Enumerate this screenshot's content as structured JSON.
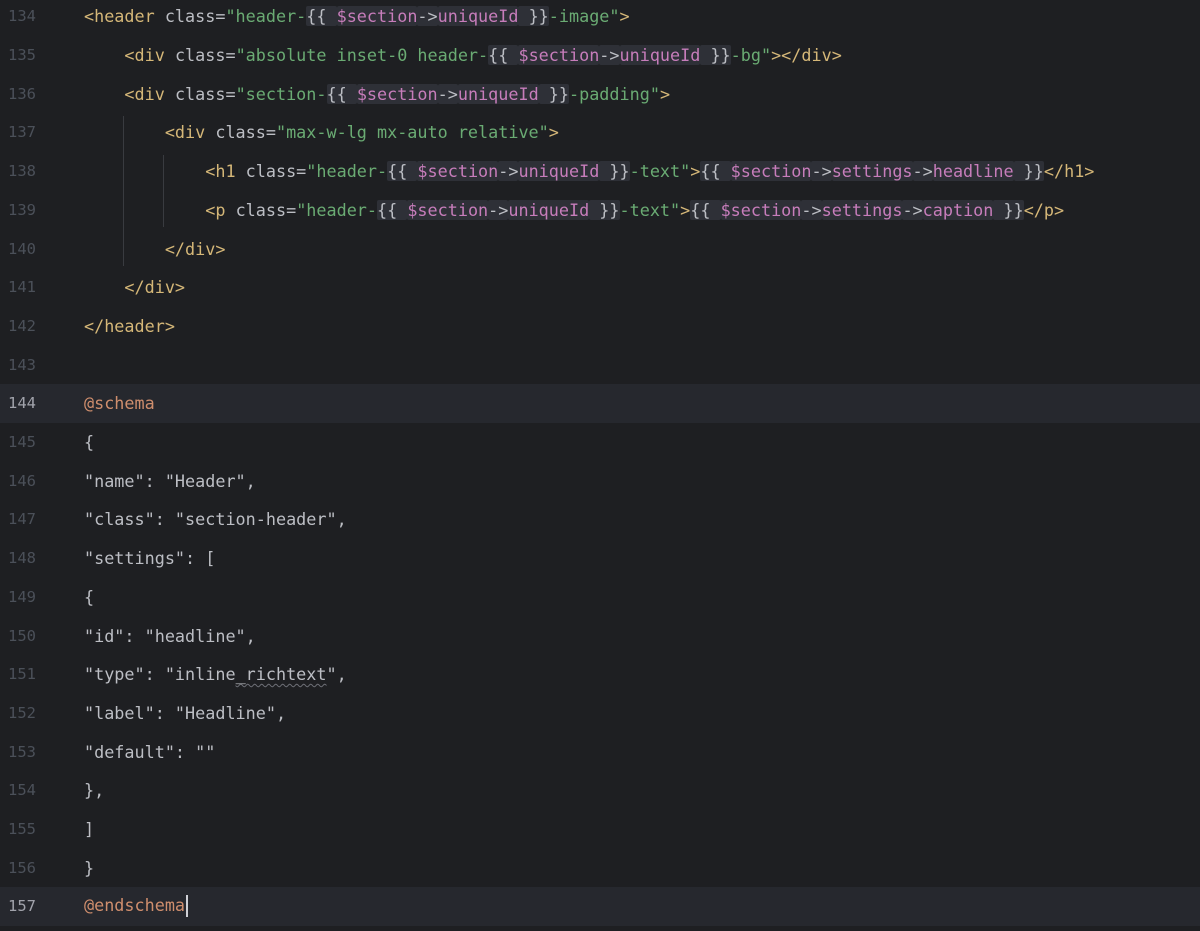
{
  "editor": {
    "lines": [
      {
        "number": "134",
        "tokens": [
          {
            "t": "<header ",
            "c": "tag"
          },
          {
            "t": "class=",
            "c": "attr"
          },
          {
            "t": "\"header-",
            "c": "str"
          },
          {
            "t": "{{ ",
            "c": "plain hl"
          },
          {
            "t": "$section",
            "c": "var hl"
          },
          {
            "t": "->",
            "c": "plain hl"
          },
          {
            "t": "uniqueId",
            "c": "var hl"
          },
          {
            "t": " }}",
            "c": "plain hl"
          },
          {
            "t": "-image\"",
            "c": "str"
          },
          {
            "t": ">",
            "c": "tag"
          }
        ]
      },
      {
        "number": "135",
        "tokens": [
          {
            "t": "    <div ",
            "c": "tag"
          },
          {
            "t": "class=",
            "c": "attr"
          },
          {
            "t": "\"absolute inset-0 header-",
            "c": "str"
          },
          {
            "t": "{{ ",
            "c": "plain hl"
          },
          {
            "t": "$section",
            "c": "var hl"
          },
          {
            "t": "->",
            "c": "plain hl"
          },
          {
            "t": "uniqueId",
            "c": "var hl"
          },
          {
            "t": " }}",
            "c": "plain hl"
          },
          {
            "t": "-bg\"",
            "c": "str"
          },
          {
            "t": "></div>",
            "c": "tag"
          }
        ]
      },
      {
        "number": "136",
        "tokens": [
          {
            "t": "    <div ",
            "c": "tag"
          },
          {
            "t": "class=",
            "c": "attr"
          },
          {
            "t": "\"section-",
            "c": "str"
          },
          {
            "t": "{{ ",
            "c": "plain hl"
          },
          {
            "t": "$section",
            "c": "var hl"
          },
          {
            "t": "->",
            "c": "plain hl"
          },
          {
            "t": "uniqueId",
            "c": "var hl"
          },
          {
            "t": " }}",
            "c": "plain hl"
          },
          {
            "t": "-padding\"",
            "c": "str"
          },
          {
            "t": ">",
            "c": "tag"
          }
        ]
      },
      {
        "number": "137",
        "tokens": [
          {
            "t": "        <div ",
            "c": "tag"
          },
          {
            "t": "class=",
            "c": "attr"
          },
          {
            "t": "\"max-w-lg mx-auto relative\"",
            "c": "str"
          },
          {
            "t": ">",
            "c": "tag"
          }
        ]
      },
      {
        "number": "138",
        "tokens": [
          {
            "t": "            <h1 ",
            "c": "tag"
          },
          {
            "t": "class=",
            "c": "attr"
          },
          {
            "t": "\"header-",
            "c": "str"
          },
          {
            "t": "{{ ",
            "c": "plain hl"
          },
          {
            "t": "$section",
            "c": "var hl"
          },
          {
            "t": "->",
            "c": "plain hl"
          },
          {
            "t": "uniqueId",
            "c": "var hl"
          },
          {
            "t": " }}",
            "c": "plain hl"
          },
          {
            "t": "-text\"",
            "c": "str"
          },
          {
            "t": ">",
            "c": "tag"
          },
          {
            "t": "{{ ",
            "c": "plain hl"
          },
          {
            "t": "$section",
            "c": "var hl"
          },
          {
            "t": "->",
            "c": "plain hl"
          },
          {
            "t": "settings",
            "c": "var hl"
          },
          {
            "t": "->",
            "c": "plain hl"
          },
          {
            "t": "headline",
            "c": "var hl"
          },
          {
            "t": " }}",
            "c": "plain hl"
          },
          {
            "t": "</h1>",
            "c": "tag"
          }
        ]
      },
      {
        "number": "139",
        "tokens": [
          {
            "t": "            <p ",
            "c": "tag"
          },
          {
            "t": "class=",
            "c": "attr"
          },
          {
            "t": "\"header-",
            "c": "str"
          },
          {
            "t": "{{ ",
            "c": "plain hl"
          },
          {
            "t": "$section",
            "c": "var hl"
          },
          {
            "t": "->",
            "c": "plain hl"
          },
          {
            "t": "uniqueId",
            "c": "var hl"
          },
          {
            "t": " }}",
            "c": "plain hl"
          },
          {
            "t": "-text\"",
            "c": "str"
          },
          {
            "t": ">",
            "c": "tag"
          },
          {
            "t": "{{ ",
            "c": "plain hl"
          },
          {
            "t": "$section",
            "c": "var hl"
          },
          {
            "t": "->",
            "c": "plain hl"
          },
          {
            "t": "settings",
            "c": "var hl"
          },
          {
            "t": "->",
            "c": "plain hl"
          },
          {
            "t": "caption",
            "c": "var hl"
          },
          {
            "t": " }}",
            "c": "plain hl"
          },
          {
            "t": "</p>",
            "c": "tag"
          }
        ]
      },
      {
        "number": "140",
        "tokens": [
          {
            "t": "        </div>",
            "c": "tag"
          }
        ]
      },
      {
        "number": "141",
        "tokens": [
          {
            "t": "    </div>",
            "c": "tag"
          }
        ]
      },
      {
        "number": "142",
        "tokens": [
          {
            "t": "</header>",
            "c": "tag"
          }
        ]
      },
      {
        "number": "143",
        "tokens": []
      },
      {
        "number": "144",
        "active": true,
        "tokens": [
          {
            "t": "@schema",
            "c": "dir"
          }
        ]
      },
      {
        "number": "145",
        "tokens": [
          {
            "t": "{",
            "c": "plain"
          }
        ]
      },
      {
        "number": "146",
        "tokens": [
          {
            "t": "\"name\": \"Header\",",
            "c": "plain"
          }
        ]
      },
      {
        "number": "147",
        "tokens": [
          {
            "t": "\"class\": \"section-header\",",
            "c": "plain"
          }
        ]
      },
      {
        "number": "148",
        "tokens": [
          {
            "t": "\"settings\": [",
            "c": "plain"
          }
        ]
      },
      {
        "number": "149",
        "tokens": [
          {
            "t": "{",
            "c": "plain"
          }
        ]
      },
      {
        "number": "150",
        "tokens": [
          {
            "t": "\"id\": \"headline\",",
            "c": "plain"
          }
        ]
      },
      {
        "number": "151",
        "tokens": [
          {
            "t": "\"type\": \"inline",
            "c": "plain"
          },
          {
            "t": "_richtext",
            "c": "plain squiggle"
          },
          {
            "t": "\",",
            "c": "plain"
          }
        ]
      },
      {
        "number": "152",
        "tokens": [
          {
            "t": "\"label\": \"Headline\",",
            "c": "plain"
          }
        ]
      },
      {
        "number": "153",
        "tokens": [
          {
            "t": "\"default\": \"\"",
            "c": "plain"
          }
        ]
      },
      {
        "number": "154",
        "tokens": [
          {
            "t": "},",
            "c": "plain"
          }
        ]
      },
      {
        "number": "155",
        "tokens": [
          {
            "t": "]",
            "c": "plain"
          }
        ]
      },
      {
        "number": "156",
        "tokens": [
          {
            "t": "}",
            "c": "plain"
          }
        ]
      },
      {
        "number": "157",
        "active": true,
        "current": true,
        "caret": true,
        "tokens": [
          {
            "t": "@endschema",
            "c": "dir"
          }
        ]
      }
    ]
  },
  "colors": {
    "background": "#1e1f22",
    "active_line": "#26282e",
    "tag": "#d5b778",
    "string": "#6aab73",
    "variable": "#c77dbb",
    "directive": "#cf8e6d",
    "text": "#bcbec4",
    "line_number": "#4b5059"
  }
}
